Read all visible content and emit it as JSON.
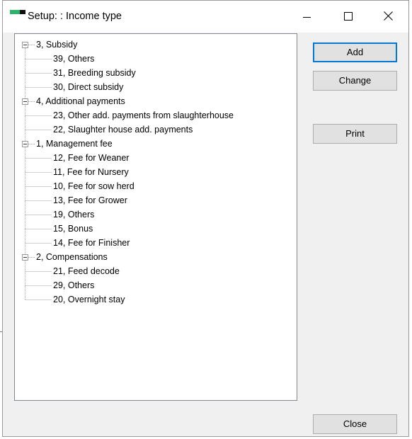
{
  "window": {
    "title": "Setup: : Income type"
  },
  "tree": [
    {
      "label": "3, Subsidy",
      "children": [
        {
          "label": "39, Others"
        },
        {
          "label": "31, Breeding subsidy"
        },
        {
          "label": "30, Direct subsidy"
        }
      ]
    },
    {
      "label": "4, Additional payments",
      "children": [
        {
          "label": "23, Other add. payments from slaughterhouse"
        },
        {
          "label": "22, Slaughter house add. payments"
        }
      ]
    },
    {
      "label": "1, Management fee",
      "children": [
        {
          "label": "12, Fee for Weaner"
        },
        {
          "label": "11, Fee for Nursery"
        },
        {
          "label": "10, Fee for sow herd"
        },
        {
          "label": "13, Fee for Grower"
        },
        {
          "label": "19, Others"
        },
        {
          "label": "15, Bonus"
        },
        {
          "label": "14, Fee for Finisher"
        }
      ]
    },
    {
      "label": "2, Compensations",
      "children": [
        {
          "label": "21, Feed decode"
        },
        {
          "label": "29, Others"
        },
        {
          "label": "20, Overnight stay"
        }
      ]
    }
  ],
  "buttons": {
    "add": "Add",
    "change": "Change",
    "print": "Print",
    "close": "Close"
  },
  "colors": {
    "accent": "#0078d7",
    "icon_green": "#2fb36a"
  }
}
